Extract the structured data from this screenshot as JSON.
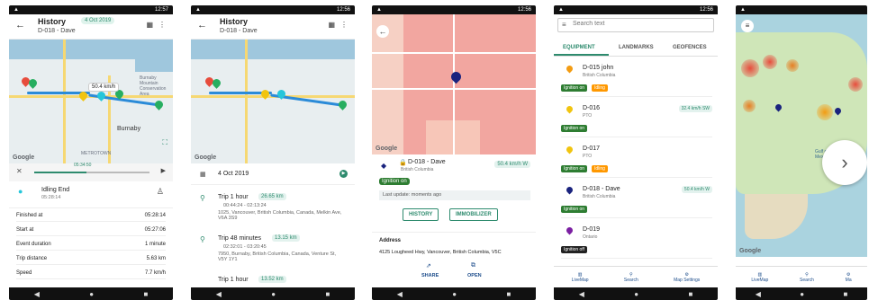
{
  "status": {
    "time1": "12:57",
    "time2": "12:56"
  },
  "screen1": {
    "title": "History",
    "date_pill": "4 Oct 2019",
    "vehicle": "D-018 - Dave",
    "speed_label": "50.4 km/h",
    "map_labels": {
      "burnaby": "Burnaby",
      "mountain": "Burnaby Mountain Conservation Area",
      "metrotown": "METROTOWN"
    },
    "google": "Google",
    "playback_time": "05:34:50",
    "event": {
      "title": "Idling End",
      "time": "05:28:14"
    },
    "stats": [
      {
        "label": "Finished at",
        "value": "05:28:14"
      },
      {
        "label": "Start at",
        "value": "05:27:06"
      },
      {
        "label": "Event duration",
        "value": "1 minute"
      },
      {
        "label": "Trip distance",
        "value": "5.63 km"
      },
      {
        "label": "Speed",
        "value": "7.7 km/h"
      }
    ]
  },
  "screen2": {
    "title": "History",
    "vehicle": "D-018 - Dave",
    "date": "4 Oct 2019",
    "google": "Google",
    "trips": [
      {
        "title": "Trip 1 hour",
        "dist": "26.65 km",
        "time": "00:44:24 - 02:13:24",
        "addr": "1025, Vancouver, British Columbia, Canada, Melkin Ave, V6A 3S9"
      },
      {
        "title": "Trip 48 minutes",
        "dist": "13.15 km",
        "time": "02:32:01 - 03:20:45",
        "addr": "7950, Burnaby, British Columbia, Canada, Venture St, V5Y 1Y1"
      },
      {
        "title": "Trip 1 hour",
        "dist": "13.52 km"
      }
    ]
  },
  "screen3": {
    "vehicle": "D-018 - Dave",
    "region": "British Columbia",
    "speed": "50.4 km/h W",
    "ignition": "Ignition on",
    "last_update": "Last update: moments ago",
    "history_btn": "HISTORY",
    "immobilizer_btn": "IMMOBILIZER",
    "address_label": "Address",
    "address": "4125 Lougheed Hwy, Vancouver, British Columbia, V5C",
    "share": "SHARE",
    "open": "OPEN",
    "google": "Google"
  },
  "screen4": {
    "search_placeholder": "Search text",
    "tabs": [
      "EQUIPMENT",
      "LANDMARKS",
      "GEOFENCES"
    ],
    "vehicles": [
      {
        "name": "D-015 john",
        "region": "British Columbia",
        "ign": "Ignition on",
        "extra": "Idling",
        "speed": "",
        "color": "#f39c12"
      },
      {
        "name": "D-016",
        "region": "PTO",
        "ign": "Ignition on",
        "extra": "",
        "speed": "32.4 km/h SW",
        "color": "#f1c40f"
      },
      {
        "name": "D-017",
        "region": "PTO",
        "ign": "Ignition on",
        "extra": "Idling",
        "speed": "",
        "color": "#f1c40f"
      },
      {
        "name": "D-018 - Dave",
        "region": "British Columbia",
        "ign": "Ignition on",
        "extra": "",
        "speed": "50.4 km/h W",
        "color": "#1a237e"
      },
      {
        "name": "D-019",
        "region": "Ontario",
        "ign": "Ignition off",
        "extra": "",
        "speed": "",
        "color": "#7b1fa2"
      }
    ],
    "bottom": [
      "LiveMap",
      "Search",
      "Map Settings"
    ]
  },
  "screen5": {
    "google": "Google",
    "gulf": "Gulf of Mexico",
    "bottom": [
      "LiveMap",
      "Search",
      "Ma"
    ]
  },
  "colors": {
    "accent": "#2e8b6e",
    "ignition": "#2e7d32",
    "idling": "#ff9800",
    "nav": "#111111"
  }
}
